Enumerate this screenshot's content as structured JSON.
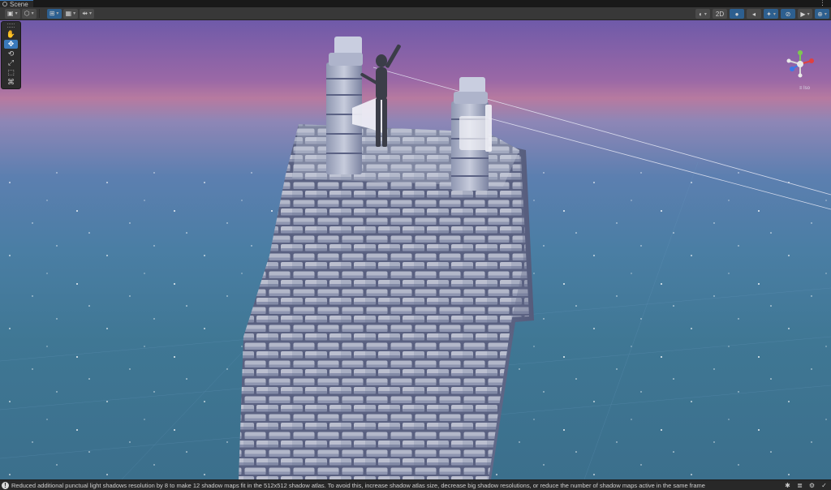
{
  "window": {
    "tab_title": "Scene",
    "kebab": "⋮"
  },
  "toolbar": {
    "left": [
      {
        "name": "draw-mode",
        "glyph": "▣"
      },
      {
        "name": "shading-mode",
        "glyph": "⬡"
      },
      {
        "name": "gizmo-toggle",
        "glyph": "⊞"
      },
      {
        "name": "grid-toggle",
        "glyph": "▦"
      },
      {
        "name": "snap-toggle",
        "glyph": "⇹"
      }
    ],
    "right": [
      {
        "name": "render-mode",
        "glyph": "◐"
      },
      {
        "name": "toggle-2d",
        "label": "2D"
      },
      {
        "name": "toggle-lighting",
        "glyph": "💡"
      },
      {
        "name": "toggle-audio",
        "glyph": "🔈"
      },
      {
        "name": "toggle-effects",
        "glyph": "✦"
      },
      {
        "name": "hidden-objects",
        "glyph": "⊘"
      },
      {
        "name": "camera-settings",
        "glyph": "▶"
      },
      {
        "name": "gizmos-menu",
        "glyph": "⊕"
      }
    ]
  },
  "tools": [
    {
      "name": "hand-tool",
      "glyph": "✋"
    },
    {
      "name": "move-tool",
      "glyph": "✥"
    },
    {
      "name": "rotate-tool",
      "glyph": "⟲"
    },
    {
      "name": "scale-tool",
      "glyph": "⤢"
    },
    {
      "name": "rect-tool",
      "glyph": "⬚"
    },
    {
      "name": "transform-tool",
      "glyph": "⌘"
    }
  ],
  "gizmo": {
    "projection_label": "≡ Iso",
    "axis_y": "y",
    "axis_x": "x"
  },
  "status": {
    "message": "Reduced additional punctual light shadows resolution by 8 to make 12 shadow maps fit in the 512x512 shadow atlas. To avoid this, increase shadow atlas size, decrease big shadow resolutions, or reduce the number of shadow maps active in the same frame",
    "icon": "!"
  },
  "colors": {
    "sky_top": "#6f5aa9",
    "horizon_pink": "#b77aa0",
    "ground_blue": "#3f7794",
    "stone": "#c9cede",
    "accent": "#3a79bb"
  }
}
